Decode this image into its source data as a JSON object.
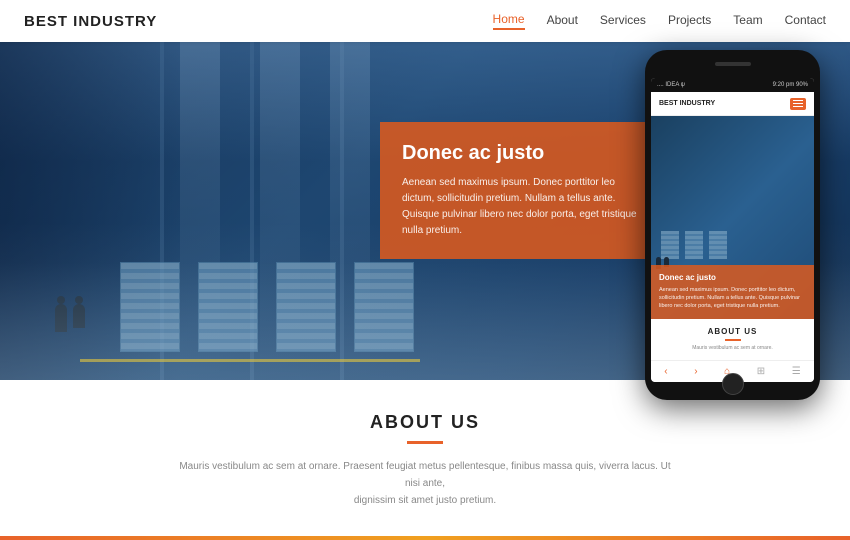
{
  "header": {
    "logo": "BEST INDUSTRY",
    "nav": [
      {
        "label": "Home",
        "active": true
      },
      {
        "label": "About",
        "active": false
      },
      {
        "label": "Services",
        "active": false
      },
      {
        "label": "Projects",
        "active": false
      },
      {
        "label": "Team",
        "active": false
      },
      {
        "label": "Contact",
        "active": false
      }
    ]
  },
  "hero": {
    "card": {
      "title": "Donec ac justo",
      "text": "Aenean sed maximus ipsum. Donec porttitor leo dictum, sollicitudin pretium. Nullam a tellus ante. Quisque pulvinar libero nec dolor porta, eget tristique nulla pretium."
    }
  },
  "about": {
    "title": "ABOUT US",
    "text1": "Mauris vestibulum ac sem at ornare. Praesent feugiat metus pellentesque, finibus massa quis, viverra lacus. Ut nisi ante,",
    "text2": "dignissim sit amet justo pretium."
  },
  "phone": {
    "status": {
      "left": ".... IDEA ψ",
      "right": "9:20 pm     90%"
    },
    "logo": "BEST INDUSTRY",
    "hero": {
      "title": "Donec ac justo",
      "text": "Aenean sed maximus ipsum. Donec porttitor leo dictum, sollicitudin pretium. Nullam a tellus ante. Quisque pulvinar libero nec dolor porta, eget tristique nulla pretium."
    },
    "about": {
      "title": "ABOUT US",
      "text": "Mauris vestibulum ac sem at ornare."
    },
    "bottomNav": [
      "‹",
      "›",
      "⌂",
      "⊞",
      "☰"
    ]
  },
  "colors": {
    "accent": "#e8622a",
    "logo_color": "#222222",
    "nav_active": "#e8622a",
    "hero_overlay": "rgba(220,90,30,0.88)"
  }
}
